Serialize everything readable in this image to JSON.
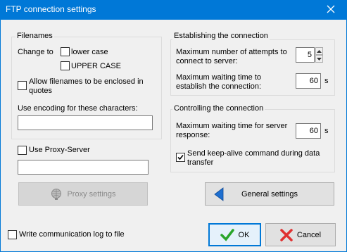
{
  "window": {
    "title": "FTP connection settings"
  },
  "filenames": {
    "group_label": "Filenames",
    "change_to_label": "Change to",
    "lower_case_label": "lower case",
    "upper_case_label": "UPPER CASE",
    "allow_enclosed_line1": "Allow filenames to be enclosed in",
    "allow_enclosed_line2": "quotes",
    "encoding_label": "Use encoding for these characters:",
    "encoding_value": ""
  },
  "proxy": {
    "use_proxy_label": "Use Proxy-Server",
    "proxy_value": "",
    "proxy_settings_label": "Proxy settings"
  },
  "establishing": {
    "group_label": "Establishing the connection",
    "max_attempts_line1": "Maximum number of attempts to",
    "max_attempts_line2": "connect to server:",
    "max_attempts_value": "5",
    "max_wait_line1": "Maximum waiting time to",
    "max_wait_line2": "establish the connection:",
    "max_wait_value": "60",
    "max_wait_unit": "s"
  },
  "controlling": {
    "group_label": "Controlling the connection",
    "server_wait_line1": "Maximum waiting time for server",
    "server_wait_line2": "response:",
    "server_wait_value": "60",
    "server_wait_unit": "s",
    "keepalive_line1": "Send keep-alive command during data",
    "keepalive_line2": "transfer",
    "keepalive_checked": true
  },
  "general_settings_label": "General settings",
  "log_label": "Write communication log to file",
  "ok_label": "OK",
  "cancel_label": "Cancel",
  "colors": {
    "titlebar": "#0078d7",
    "ok_check": "#2aa52a",
    "cancel_x": "#e03030",
    "arrow": "#1e6fd0"
  }
}
